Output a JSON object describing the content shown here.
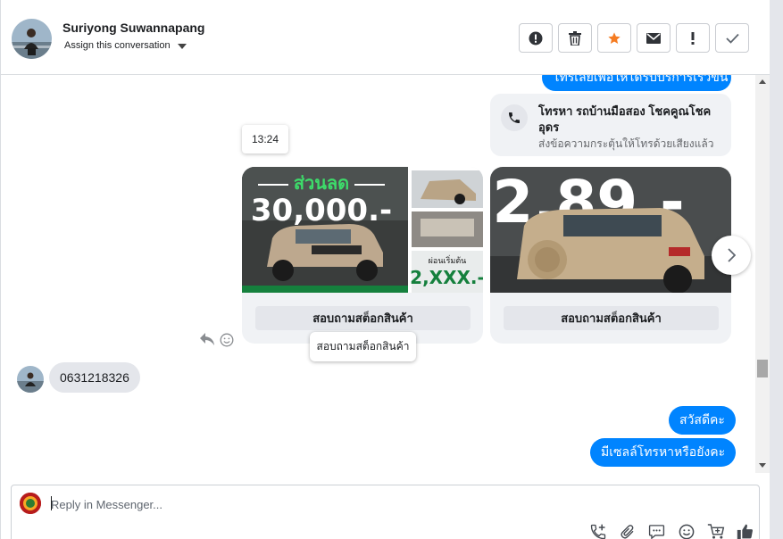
{
  "header": {
    "contact_name": "Suriyong Suwannapang",
    "assign_label": "Assign this conversation",
    "actions": [
      {
        "name": "report-spam-button",
        "icon": "alert-circle-icon"
      },
      {
        "name": "delete-button",
        "icon": "trash-icon"
      },
      {
        "name": "star-button",
        "icon": "star-icon"
      },
      {
        "name": "mark-unread-button",
        "icon": "envelope-icon"
      },
      {
        "name": "follow-up-button",
        "icon": "exclamation-icon"
      },
      {
        "name": "mark-done-button",
        "icon": "checkmark-icon"
      }
    ]
  },
  "conversation": {
    "cut_bubble_text": "โทรเลยเพื่อให้ได้รับบริการเร็วขึ้น",
    "call_card": {
      "title": "โทรหา รถบ้านมือสอง โชคคูณโชคอุดร",
      "subtitle": "ส่งข้อความกระตุ้นให้โทรด้วยเสียงแล้ว"
    },
    "time_tooltip": "13:24",
    "cards": [
      {
        "button_label": "สอบถามสต็อกสินค้า",
        "price_banner": "ส่วนลด",
        "price_big": "30,000.-",
        "side_label": "ผ่อนเริ่มต้น",
        "side_price": "2,XXX.-"
      },
      {
        "button_label": "สอบถามสต็อกสินค้า",
        "price_big": "2.89.-"
      }
    ],
    "button_tooltip": "สอบถามสต็อกสินค้า",
    "incoming_message": "0631218326",
    "outgoing_messages": [
      "สวัสดีคะ",
      "มีเซลล์โทรหาหรือยังคะ"
    ]
  },
  "composer": {
    "placeholder": "Reply in Messenger..."
  },
  "colors": {
    "accent": "#0084ff",
    "star": "#f57c22",
    "bubble_in": "#e4e6eb",
    "card_bg": "#f0f2f5"
  }
}
